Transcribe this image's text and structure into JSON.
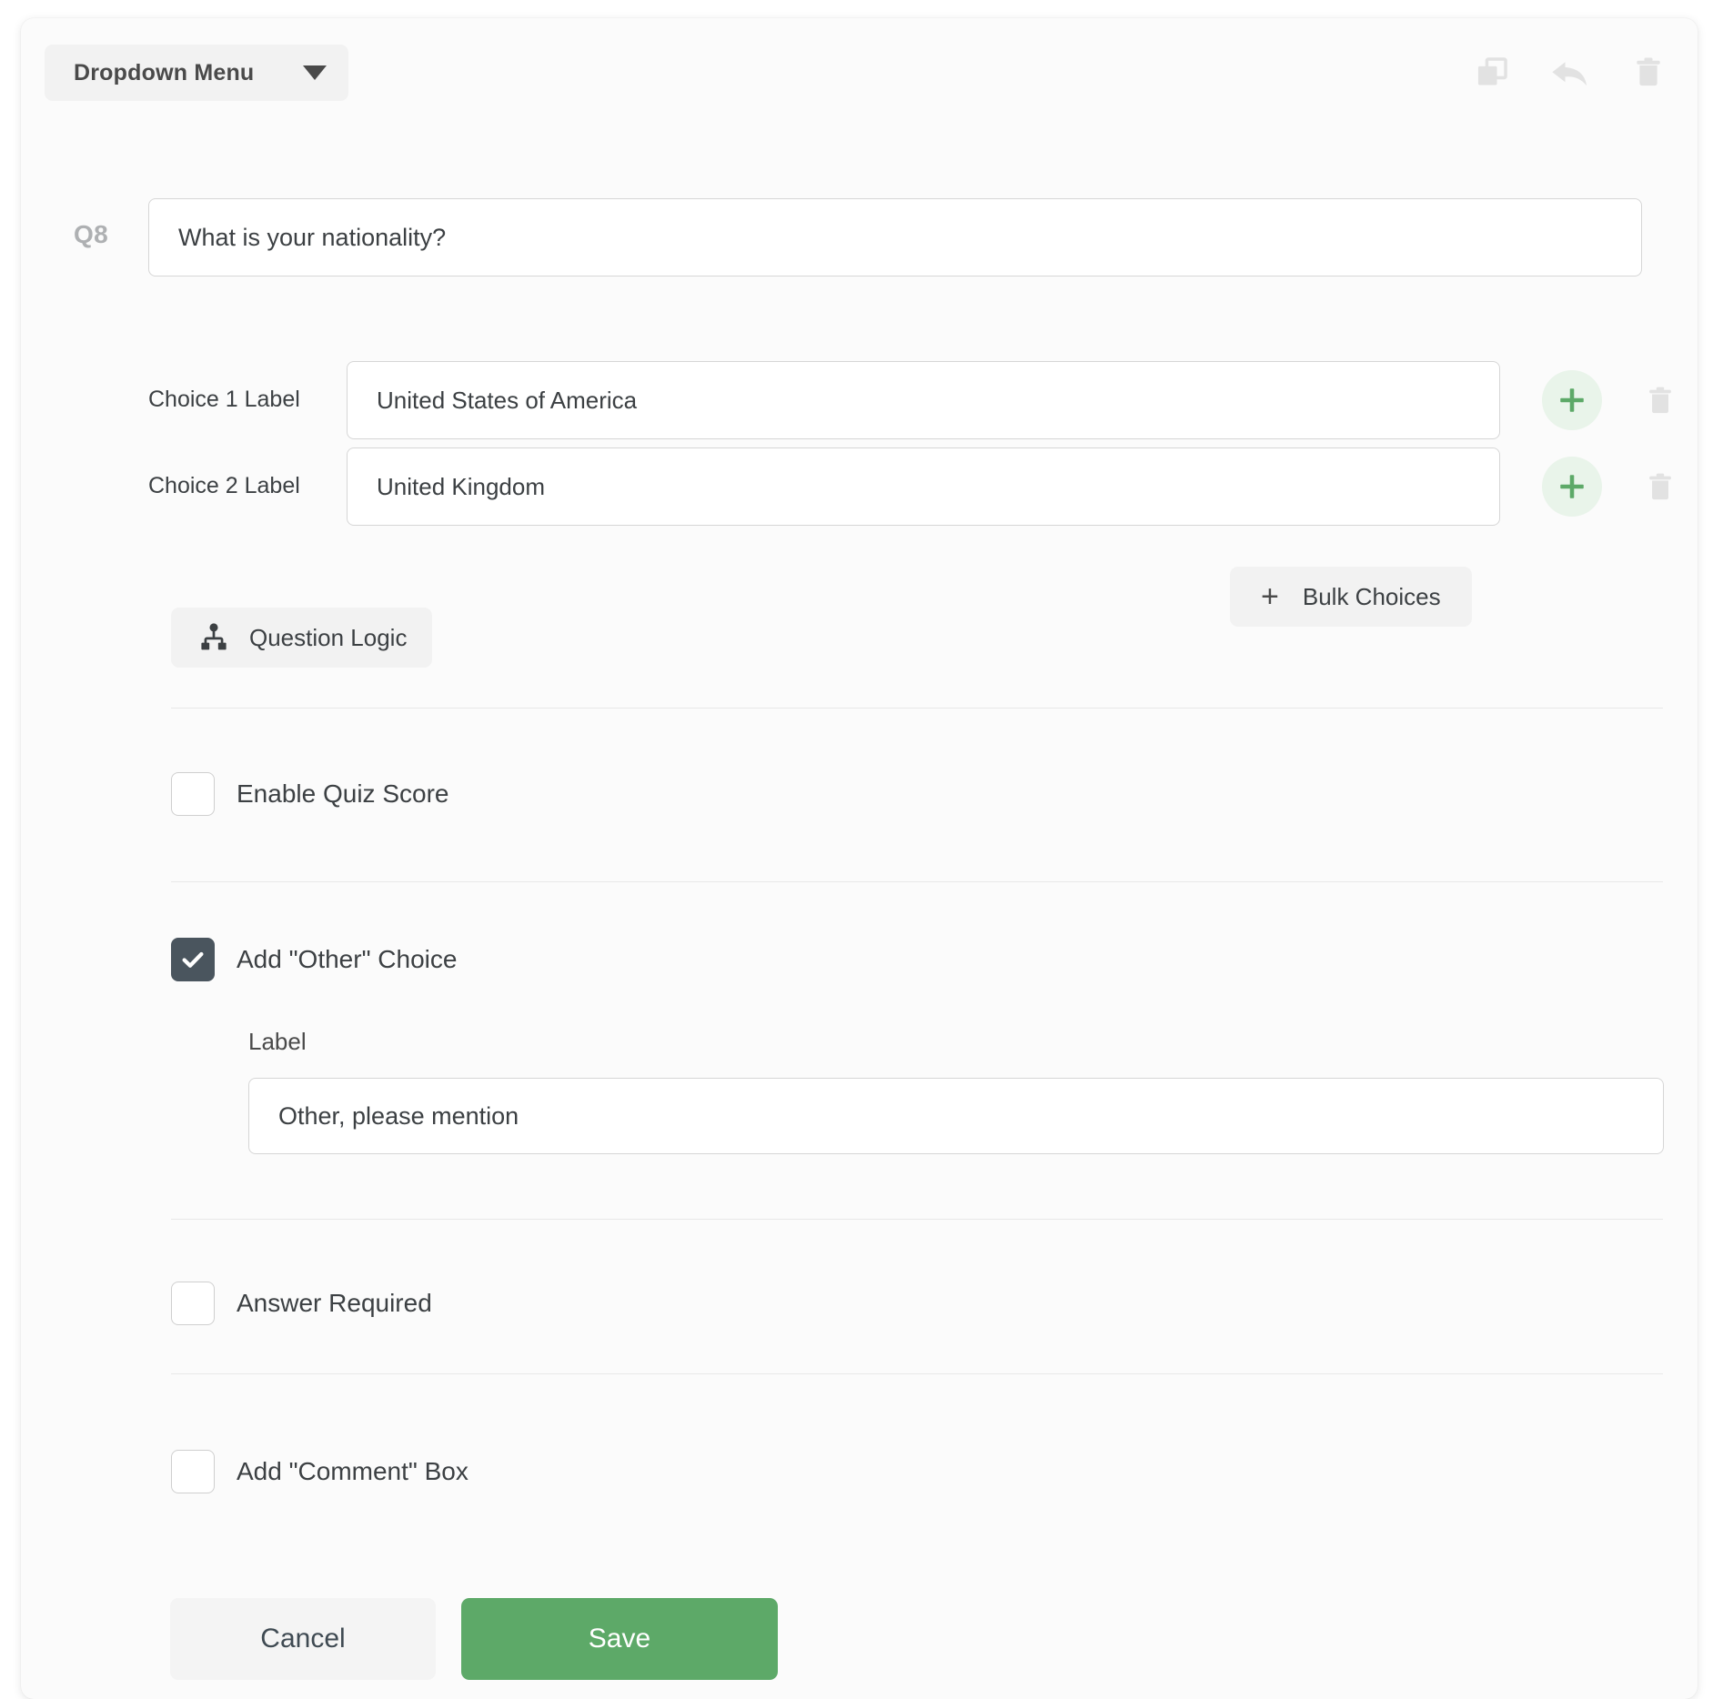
{
  "header": {
    "question_type": "Dropdown Menu",
    "caret_icon": "chevron-down-icon",
    "actions": [
      {
        "name": "duplicate-icon",
        "title": "Copy"
      },
      {
        "name": "undo-icon",
        "title": "Undo"
      },
      {
        "name": "trash-icon",
        "title": "Delete"
      }
    ]
  },
  "question": {
    "number": "Q8",
    "text": "What is your nationality?",
    "placeholder": "Enter your question"
  },
  "choices": [
    {
      "label": "Choice 1 Label",
      "value": "United States of America",
      "placeholder": "Enter choice",
      "add_icon": "plus-icon",
      "delete_icon": "trash-icon"
    },
    {
      "label": "Choice 2 Label",
      "value": "United Kingdom",
      "placeholder": "Enter choice",
      "add_icon": "plus-icon",
      "delete_icon": "trash-icon"
    }
  ],
  "bulk_choices": {
    "label": "Bulk Choices",
    "icon": "plus-icon"
  },
  "question_logic": {
    "label": "Question Logic",
    "icon": "sitemap-icon"
  },
  "options": {
    "quiz_score": {
      "label": "Enable Quiz Score",
      "checked": false
    },
    "other_choice": {
      "label": "Add \"Other\" Choice",
      "checked": true
    },
    "answer_required": {
      "label": "Answer Required",
      "checked": false
    },
    "comment_box": {
      "label": "Add \"Comment\" Box",
      "checked": false
    }
  },
  "other_label": {
    "field_label": "Label",
    "value": "Other, please mention",
    "placeholder": "Other, please mention"
  },
  "footer": {
    "cancel_label": "Cancel",
    "save_label": "Save"
  },
  "colors": {
    "accent_green": "#5da968",
    "plus_green": "#5da968",
    "plus_bg": "#e9f4ea",
    "checkbox_checked": "#4a555e",
    "card_bg": "#fbfbfb",
    "pill_bg": "#f2f2f2",
    "input_border": "#d6d6d6",
    "divider": "#e8e8e8",
    "icon_gray": "#e2e2e2"
  }
}
